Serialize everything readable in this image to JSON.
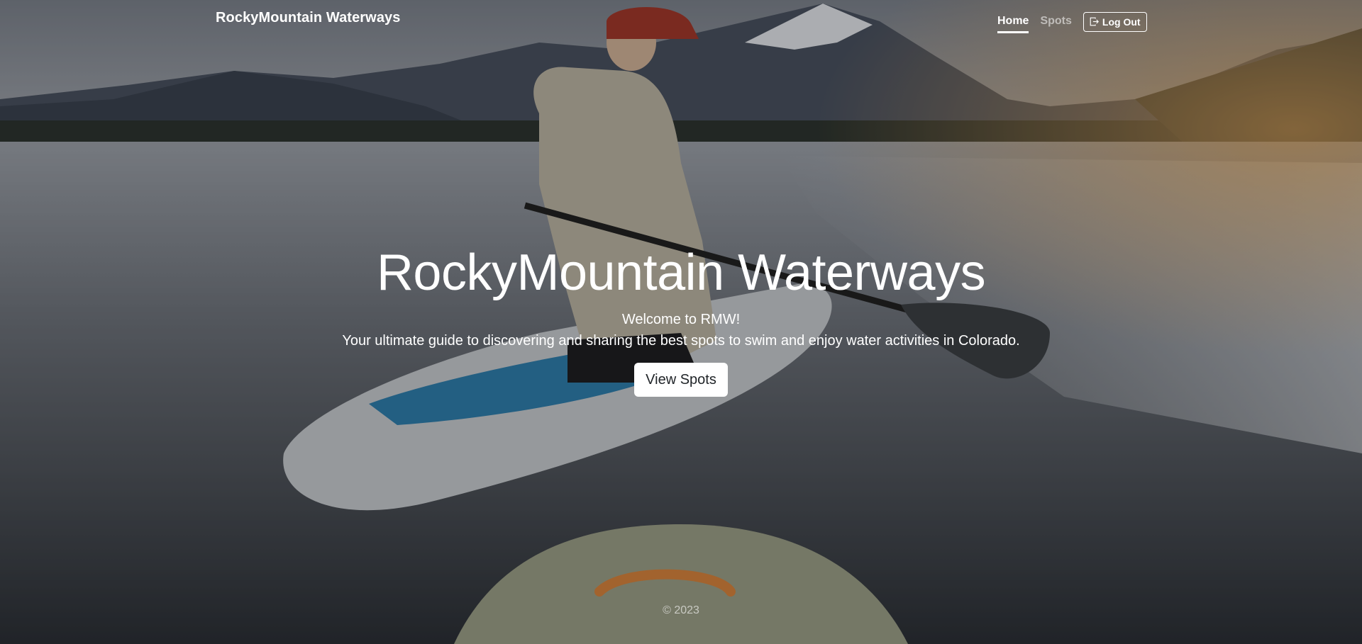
{
  "brand": "RockyMountain Waterways",
  "nav": {
    "home": "Home",
    "spots": "Spots",
    "logout": "Log Out"
  },
  "hero": {
    "title": "RockyMountain Waterways",
    "welcome": "Welcome to RMW!",
    "tagline": "Your ultimate guide to discovering and sharing the best spots to swim and enjoy water activities in Colorado.",
    "cta": "View Spots"
  },
  "footer": {
    "copyright": "© 2023"
  },
  "icons": {
    "logout": "box-arrow-right-icon"
  },
  "colors": {
    "text": "#ffffff",
    "muted_link": "rgba(255,255,255,0.55)",
    "button_bg": "#ffffff",
    "button_text": "#212529"
  }
}
